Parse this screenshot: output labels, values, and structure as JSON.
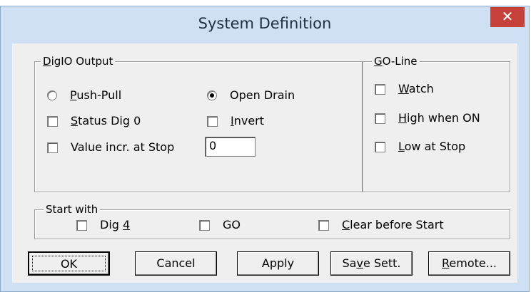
{
  "dialog": {
    "title": "System Definition",
    "close_symbol": "✕"
  },
  "digio": {
    "legend_u": "D",
    "legend_rest": "igIO Output",
    "push_pull": {
      "u": "P",
      "rest": "ush-Pull",
      "checked": false
    },
    "open_drain": {
      "label": "Open Drain",
      "checked": true
    },
    "status_dig0": {
      "u": "S",
      "rest": "tatus Dig 0",
      "checked": false
    },
    "invert": {
      "u": "I",
      "rest": "nvert",
      "checked": false
    },
    "value_incr": {
      "label": "Value incr. at Stop",
      "checked": false
    },
    "value_field": "0"
  },
  "goline": {
    "legend_u": "G",
    "legend_rest": "O-Line",
    "watch": {
      "u": "W",
      "rest": "atch",
      "checked": false
    },
    "high_on": {
      "u": "H",
      "rest": "igh when ON",
      "checked": false
    },
    "low_stop": {
      "u": "L",
      "rest": "ow at Stop",
      "checked": false
    }
  },
  "start_with": {
    "legend": "Start with",
    "dig4": {
      "pre": "Dig ",
      "u": "4",
      "checked": false
    },
    "go": {
      "label": "GO",
      "checked": false
    },
    "clear": {
      "u": "C",
      "rest": "lear before Start",
      "checked": false
    }
  },
  "buttons": {
    "ok": "OK",
    "cancel": "Cancel",
    "apply": "Apply",
    "save_pre": "Sa",
    "save_u": "v",
    "save_rest": "e Sett.",
    "remote_u": "R",
    "remote_rest": "emote..."
  },
  "colors": {
    "titlebar": "#cfe0f4",
    "close": "#c7413b",
    "face": "#efefef"
  }
}
